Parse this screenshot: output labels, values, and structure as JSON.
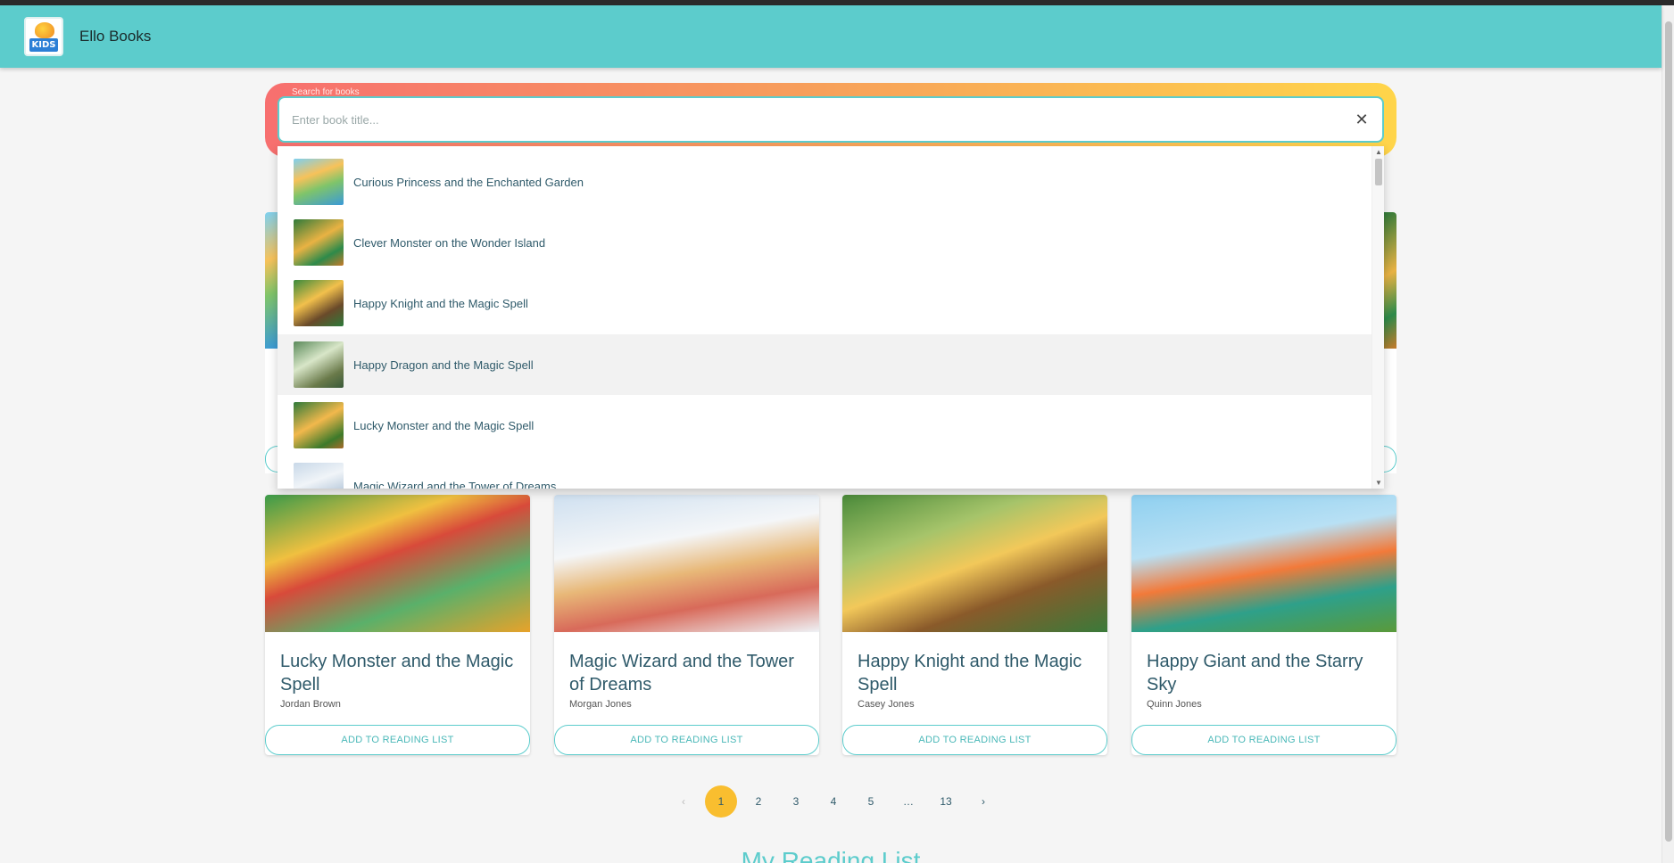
{
  "header": {
    "title": "Ello Books",
    "logo_text": "KIDS"
  },
  "search": {
    "label": "Search for books",
    "placeholder": "Enter book title...",
    "value": "",
    "clear_icon": "close-icon",
    "results": [
      {
        "title": "Curious Princess and the Enchanted Garden"
      },
      {
        "title": "Clever Monster on the Wonder Island"
      },
      {
        "title": "Happy Knight and the Magic Spell"
      },
      {
        "title": "Happy Dragon and the Magic Spell",
        "highlighted": true
      },
      {
        "title": "Lucky Monster and the Magic Spell"
      },
      {
        "title": "Magic Wizard and the Tower of Dreams"
      }
    ]
  },
  "books": [
    {
      "title": "Lucky Monster and the Magic Spell",
      "author": "Jordan Brown",
      "button": "ADD TO READING LIST"
    },
    {
      "title": "Magic Wizard and the Tower of Dreams",
      "author": "Morgan Jones",
      "button": "ADD TO READING LIST"
    },
    {
      "title": "Happy Knight and the Magic Spell",
      "author": "Casey Jones",
      "button": "ADD TO READING LIST"
    },
    {
      "title": "Happy Giant and the Starry Sky",
      "author": "Quinn Jones",
      "button": "ADD TO READING LIST"
    }
  ],
  "pagination": {
    "current": "1",
    "pages": [
      "1",
      "2",
      "3",
      "4",
      "5",
      "…",
      "13"
    ],
    "prev_icon": "chevron-left-icon",
    "next_icon": "chevron-right-icon"
  },
  "reading_list": {
    "heading": "My Reading List"
  },
  "colors": {
    "primary": "#5ccccc",
    "accent": "#f9be2f",
    "text": "#2f5a6a"
  }
}
